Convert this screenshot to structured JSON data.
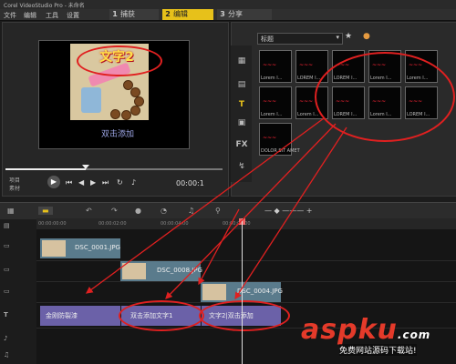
{
  "app": {
    "title": "Corel VideoStudio Pro - 未命名"
  },
  "menu": [
    {
      "label": "文件"
    },
    {
      "label": "编辑"
    },
    {
      "label": "工具"
    },
    {
      "label": "设置"
    }
  ],
  "steps": [
    {
      "num": "1",
      "label": "捕获"
    },
    {
      "num": "2",
      "label": "编辑"
    },
    {
      "num": "3",
      "label": "分享"
    }
  ],
  "preview": {
    "overlay_title": "文字2",
    "caption": "双击添加",
    "label_project": "项目",
    "label_clip": "素材",
    "timecode": "00:00:1 ",
    "progress": 0.37
  },
  "library": {
    "category": "标题",
    "thumbnails": [
      {
        "label": "Lorem I..."
      },
      {
        "label": "LOREM I..."
      },
      {
        "label": "LOREM I..."
      },
      {
        "label": "Lorem I..."
      },
      {
        "label": "Lorem I..."
      },
      {
        "label": "Lorem I..."
      },
      {
        "label": "Lorem I..."
      },
      {
        "label": "LOREM I..."
      },
      {
        "label": "Lorem I..."
      },
      {
        "label": "LOREM I..."
      },
      {
        "label": "DOLOR SIT AMET"
      }
    ]
  },
  "ruler": [
    "00:00:00:00",
    "00:00:02:00",
    "00:00:04:00",
    "00:00:06:00"
  ],
  "tracks": {
    "video": [
      {
        "label": "DSC_0001.JPG"
      }
    ],
    "overlay1": [
      {
        "label": "DSC_0008.JPG"
      }
    ],
    "overlay2": [
      {
        "label": "DSC_0004.JPG"
      }
    ],
    "titles": [
      {
        "label": "金刚防裂漆"
      },
      {
        "label": "双击添加文字1"
      },
      {
        "label": "文字2|双击添加"
      }
    ]
  },
  "watermark": {
    "brand": "aspku",
    "suffix": ".com",
    "tagline": "免费网站源码下载站!"
  },
  "colors": {
    "accent": "#e7c11a",
    "annotation": "#e02020",
    "title_clip": "#6b61a8"
  }
}
